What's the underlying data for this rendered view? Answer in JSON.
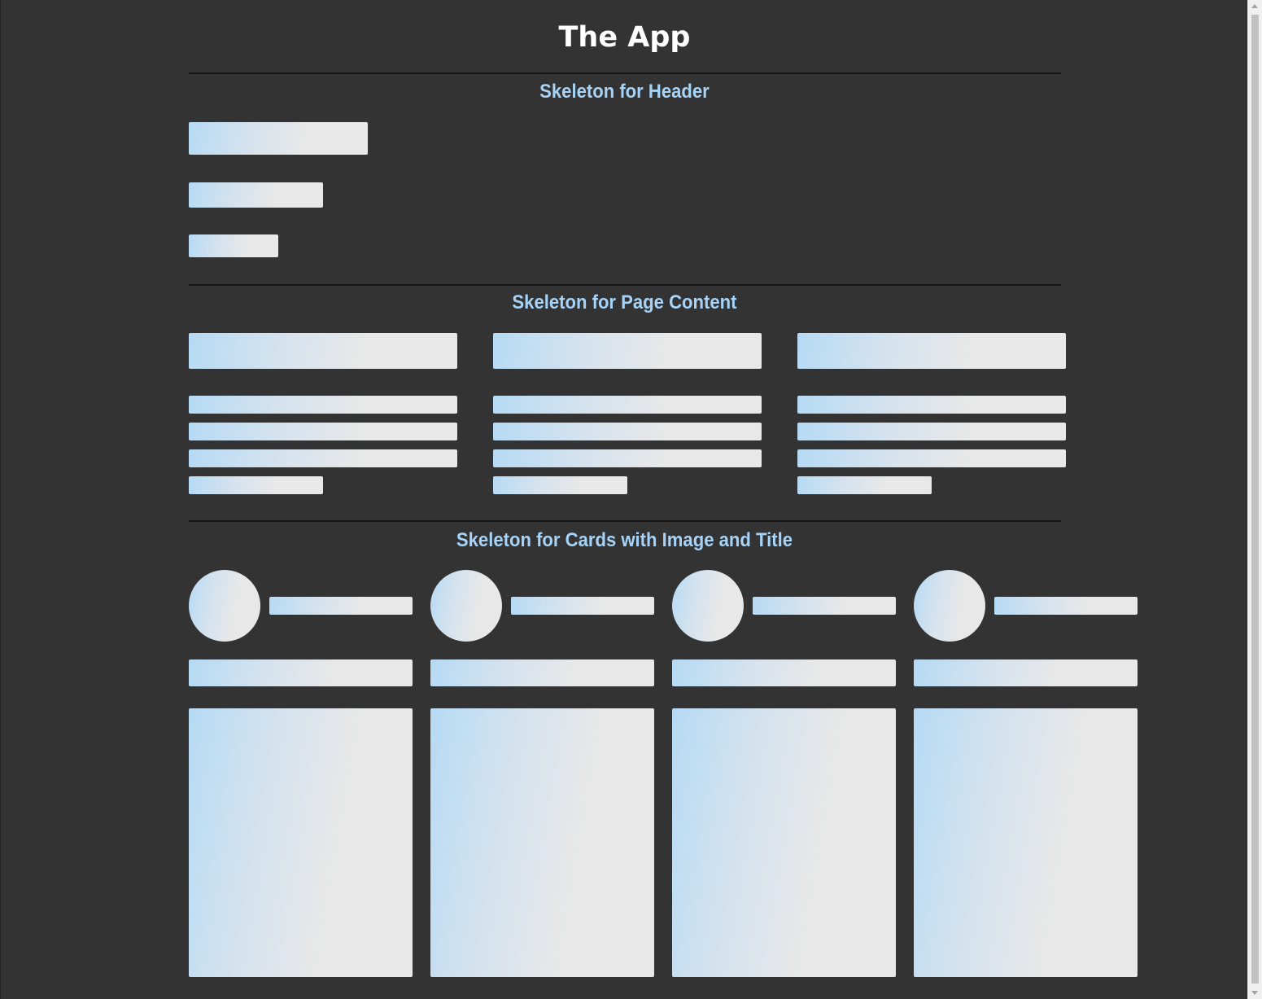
{
  "app": {
    "title": "The App"
  },
  "sections": {
    "header": {
      "title": "Skeleton for Header"
    },
    "content": {
      "title": "Skeleton for Page Content"
    },
    "cards": {
      "title": "Skeleton for Cards with Image and Title"
    }
  },
  "colors": {
    "background": "#333333",
    "title_text": "#ffffff",
    "section_title_text": "#a6d3f7",
    "skeleton_start": "#b6daf4",
    "skeleton_end": "#e8e8e8",
    "divider": "#151515"
  },
  "counts": {
    "content_columns": 3,
    "content_lines_per_column": 4,
    "cards": 4
  }
}
